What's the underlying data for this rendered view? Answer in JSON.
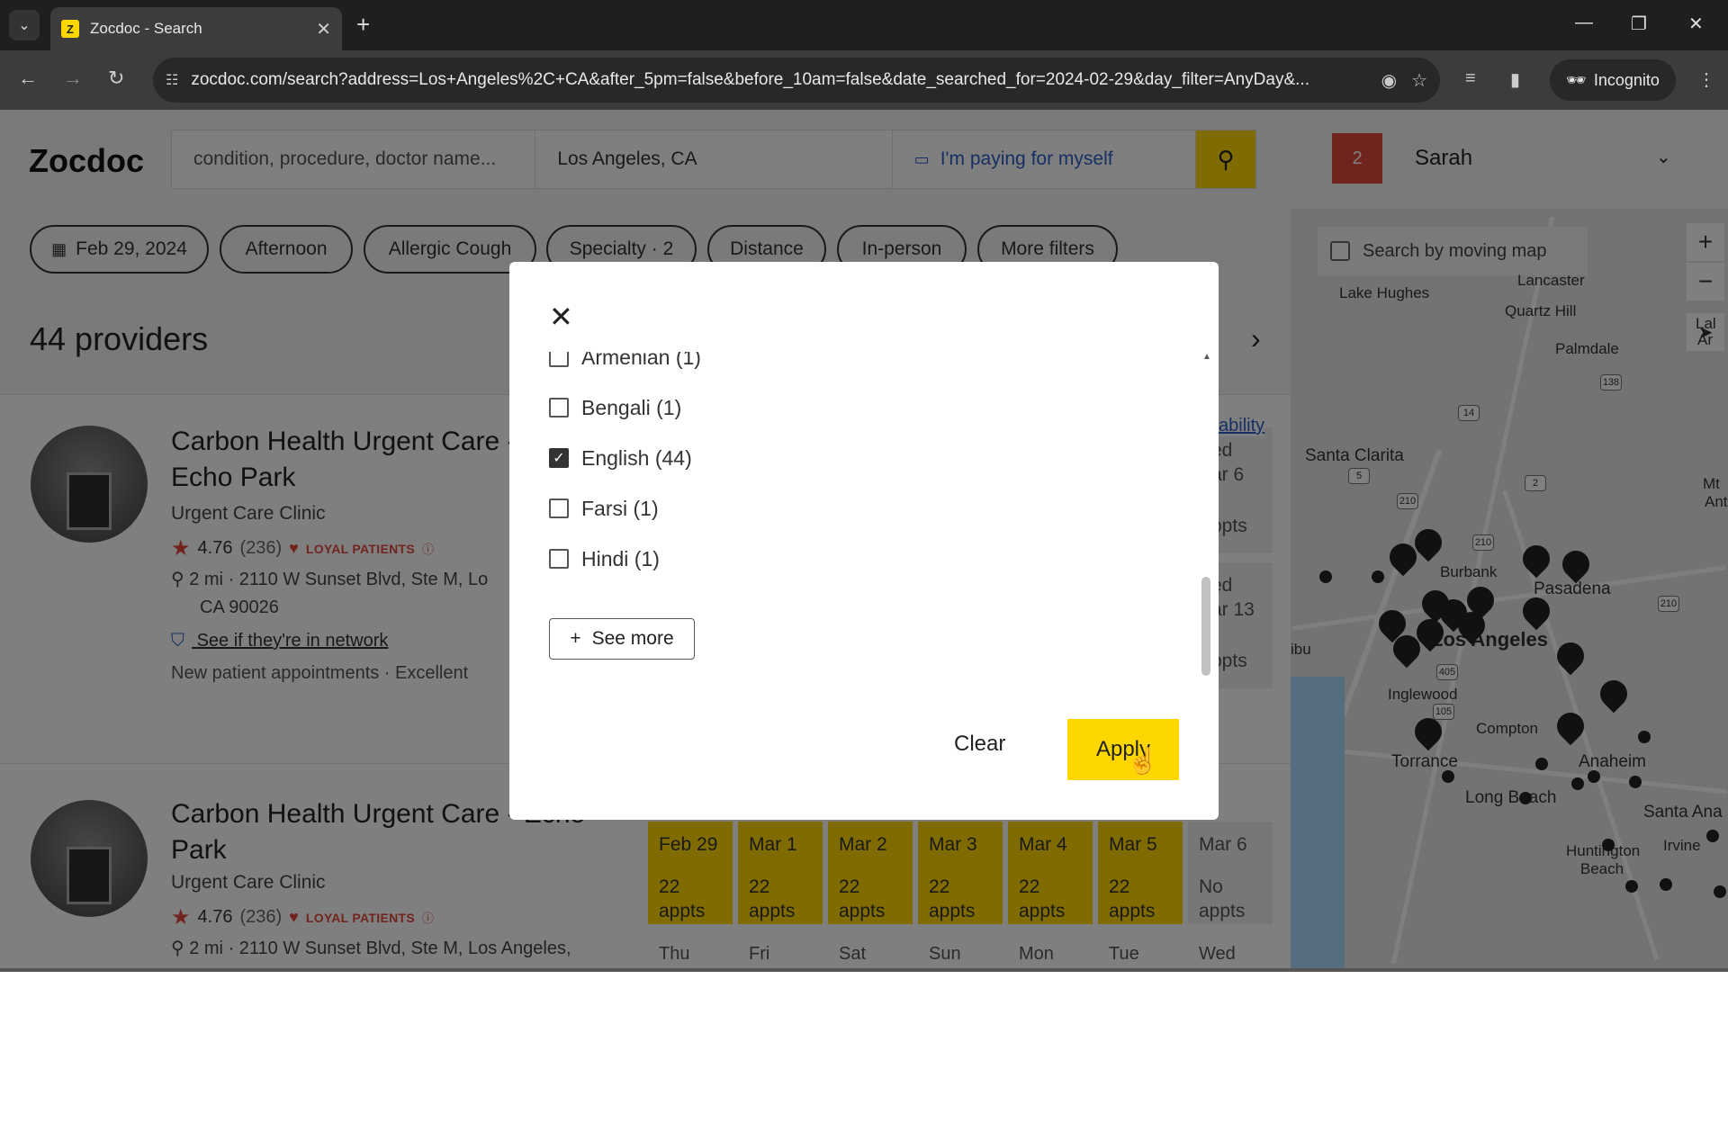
{
  "browser": {
    "tab_title": "Zocdoc - Search",
    "favicon_letter": "Z",
    "url": "zocdoc.com/search?address=Los+Angeles%2C+CA&after_5pm=false&before_10am=false&date_searched_for=2024-02-29&day_filter=AnyDay&...",
    "incognito_label": "Incognito"
  },
  "header": {
    "logo": "Zocdoc",
    "search_placeholder": "condition, procedure, doctor name...",
    "location": "Los Angeles, CA",
    "insurance": "I'm paying for myself",
    "notification_count": "2",
    "user_name": "Sarah"
  },
  "filters": [
    {
      "label": "Feb 29, 2024"
    },
    {
      "label": "Afternoon"
    },
    {
      "label": "Allergic Cough"
    },
    {
      "label": "Specialty · 2"
    },
    {
      "label": "Distance"
    },
    {
      "label": "In-person"
    },
    {
      "label": "More filters"
    }
  ],
  "results": {
    "count": "44 providers",
    "availability_link": "ability",
    "providers": [
      {
        "name": "Carbon Health Urgent Care - Echo Park",
        "type": "Urgent Care Clinic",
        "rating": "4.76",
        "reviews": "(236)",
        "loyal": "LOYAL PATIENTS",
        "distance": "2 mi",
        "address1": "2110 W Sunset Blvd, Ste M, Lo",
        "address2": "CA 90026",
        "network": "See if they're in network",
        "new_patient": "New patient appointments · Excellent",
        "partial_col": [
          "ed",
          "ar 6",
          "ppts",
          "ed",
          "ar 13",
          "ppts"
        ]
      },
      {
        "name": "Carbon Health Urgent Care - Echo Park",
        "type": "Urgent Care Clinic",
        "rating": "4.76",
        "reviews": "(236)",
        "loyal": "LOYAL PATIENTS",
        "distance": "2 mi",
        "address1": "2110 W Sunset Blvd, Ste M, Los Angeles,",
        "slots": [
          {
            "date": "Feb 29",
            "count": "22",
            "unit": "appts"
          },
          {
            "date": "Mar 1",
            "count": "22",
            "unit": "appts"
          },
          {
            "date": "Mar 2",
            "count": "22",
            "unit": "appts"
          },
          {
            "date": "Mar 3",
            "count": "22",
            "unit": "appts"
          },
          {
            "date": "Mar 4",
            "count": "22",
            "unit": "appts"
          },
          {
            "date": "Mar 5",
            "count": "22",
            "unit": "appts"
          },
          {
            "date": "Mar 6",
            "count": "No",
            "unit": "appts"
          }
        ],
        "next_days": [
          "Thu",
          "Fri",
          "Sat",
          "Sun",
          "Mon",
          "Tue",
          "Wed"
        ]
      }
    ]
  },
  "map": {
    "toggle_label": "Search by moving map",
    "labels": [
      "Lake Hughes",
      "Lancaster",
      "Quartz Hill",
      "Palmdale",
      "Santa Clarita",
      "Burbank",
      "Pasadena",
      "Los Angeles",
      "Inglewood",
      "Compton",
      "Torrance",
      "Anaheim",
      "Long Beach",
      "Santa Ana",
      "Irvine",
      "Huntington Beach",
      "Mt",
      "Ant",
      "Lal",
      "Ar",
      "ibu"
    ],
    "shields": [
      "14",
      "138",
      "5",
      "2",
      "210",
      "210",
      "210",
      "105",
      "405"
    ]
  },
  "modal": {
    "languages": [
      {
        "label": "Armenian (1)",
        "checked": false
      },
      {
        "label": "Bengali (1)",
        "checked": false
      },
      {
        "label": "English (44)",
        "checked": true
      },
      {
        "label": "Farsi (1)",
        "checked": false
      },
      {
        "label": "Hindi (1)",
        "checked": false
      }
    ],
    "see_more": "See more",
    "clear": "Clear",
    "apply": "Apply"
  }
}
